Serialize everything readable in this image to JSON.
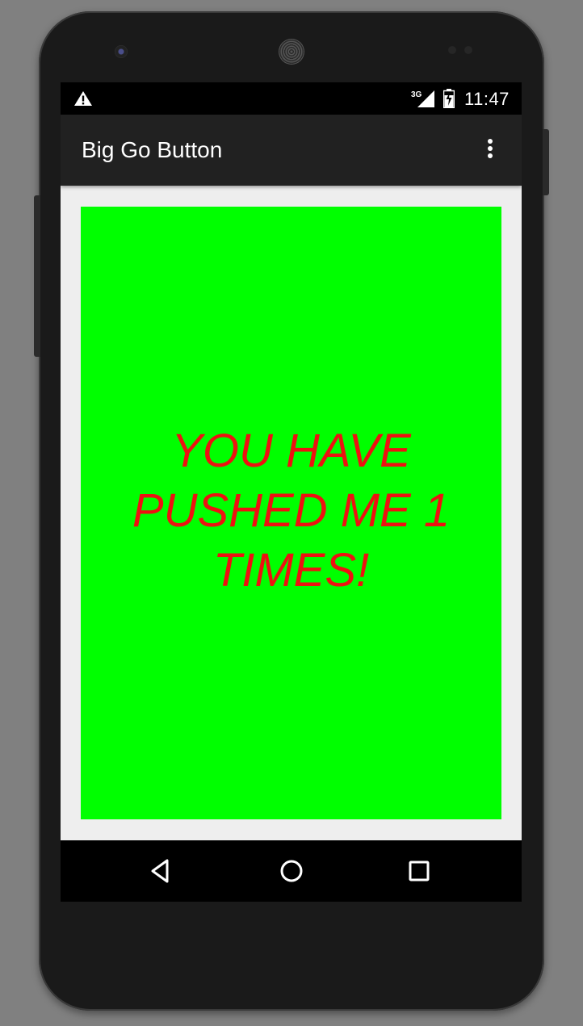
{
  "status_bar": {
    "time": "11:47",
    "network_label": "3G",
    "icons": [
      "warning-icon",
      "signal-3g-icon",
      "battery-charging-icon"
    ]
  },
  "app_bar": {
    "title": "Big Go Button",
    "overflow_icon": "overflow-menu-icon"
  },
  "main": {
    "go_button_label": "YOU HAVE PUSHED ME 1 TIMES!",
    "push_count": 1,
    "button_color": "#00ff00",
    "label_color": "#ee1111"
  },
  "nav_bar": {
    "icons": [
      "back-icon",
      "home-icon",
      "recents-icon"
    ]
  },
  "colors": {
    "status_bar": "#000000",
    "app_bar": "#212121",
    "screen_background": "#eeeeee",
    "device_frame": "#1a1a1a",
    "outer_background": "#808080"
  }
}
